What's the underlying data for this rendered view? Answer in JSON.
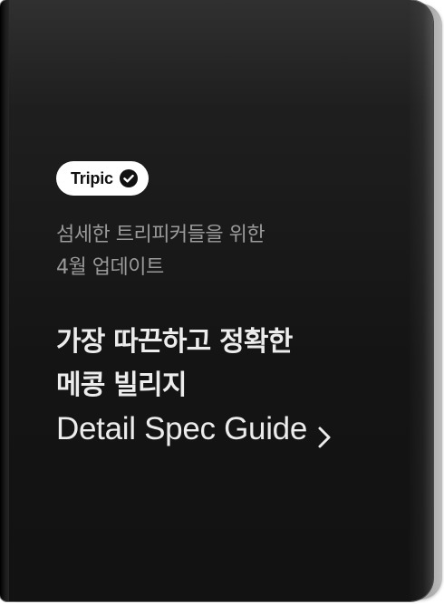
{
  "badge": {
    "label": "Tripic",
    "icon": "check-circle-icon"
  },
  "subtitle": {
    "lines": [
      "섬세한 트리피커들을 위한",
      "4월 업데이트"
    ]
  },
  "headline": {
    "lines": [
      "가장 따끈하고 정확한",
      "메콩 빌리지"
    ]
  },
  "cta": {
    "label": "Detail Spec Guide",
    "icon": "chevron-right-icon"
  },
  "colors": {
    "card_background": "#141414",
    "badge_background": "#ffffff",
    "subtitle_text": "#9a9a9a",
    "headline_text": "#ececec"
  }
}
